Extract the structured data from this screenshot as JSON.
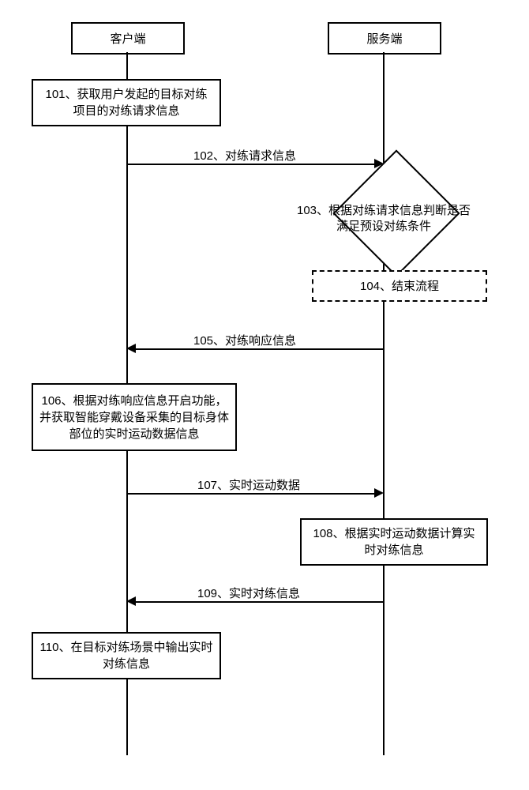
{
  "lanes": {
    "client": "客户端",
    "server": "服务端"
  },
  "steps": {
    "s101": "101、获取用户发起的目标对练项目的对练请求信息",
    "s102": "102、对练请求信息",
    "s103": "103、根据对练请求信息判断是否满足预设对练条件",
    "s104": "104、结束流程",
    "s105": "105、对练响应信息",
    "s106": "106、根据对练响应信息开启功能，并获取智能穿戴设备采集的目标身体部位的实时运动数据信息",
    "s107": "107、实时运动数据",
    "s108": "108、根据实时运动数据计算实时对练信息",
    "s109": "109、实时对练信息",
    "s110": "110、在目标对练场景中输出实时对练信息"
  },
  "chart_data": {
    "type": "sequence-flowchart",
    "lanes": [
      "客户端",
      "服务端"
    ],
    "nodes": [
      {
        "id": "101",
        "lane": "客户端",
        "shape": "process",
        "text": "获取用户发起的目标对练项目的对练请求信息"
      },
      {
        "id": "103",
        "lane": "服务端",
        "shape": "decision",
        "text": "根据对练请求信息判断是否满足预设对练条件"
      },
      {
        "id": "104",
        "lane": "服务端",
        "shape": "process-dashed",
        "text": "结束流程"
      },
      {
        "id": "106",
        "lane": "客户端",
        "shape": "process",
        "text": "根据对练响应信息开启功能，并获取智能穿戴设备采集的目标身体部位的实时运动数据信息"
      },
      {
        "id": "108",
        "lane": "服务端",
        "shape": "process",
        "text": "根据实时运动数据计算实时对练信息"
      },
      {
        "id": "110",
        "lane": "客户端",
        "shape": "process",
        "text": "在目标对练场景中输出实时对练信息"
      }
    ],
    "messages": [
      {
        "id": "102",
        "from": "客户端",
        "to": "服务端",
        "text": "对练请求信息"
      },
      {
        "id": "105",
        "from": "服务端",
        "to": "客户端",
        "text": "对练响应信息"
      },
      {
        "id": "107",
        "from": "客户端",
        "to": "服务端",
        "text": "实时运动数据"
      },
      {
        "id": "109",
        "from": "服务端",
        "to": "客户端",
        "text": "实时对练信息"
      }
    ],
    "edges": [
      {
        "from": "103",
        "to": "104",
        "kind": "decision-branch"
      }
    ]
  }
}
